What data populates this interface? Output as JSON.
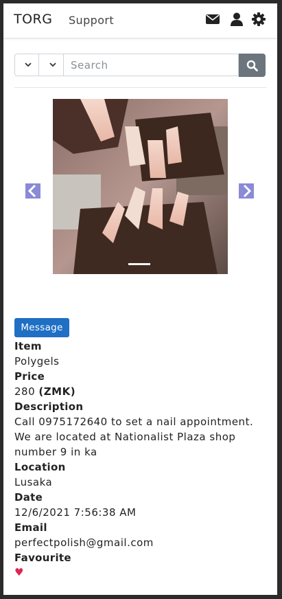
{
  "navbar": {
    "brand": "TORG",
    "support_link": "Support",
    "icons": [
      "envelope-icon",
      "user-icon",
      "gear-icon"
    ]
  },
  "search": {
    "placeholder": "Search",
    "value": "",
    "select1_value": "",
    "select2_value": ""
  },
  "carousel": {
    "slide_count": 1,
    "active_slide": 1
  },
  "listing": {
    "message_button": "Message",
    "item_label": "Item",
    "item_value": "Polygels",
    "price_label": "Price",
    "price_value": "280",
    "price_currency": "(ZMK)",
    "description_label": "Description",
    "description_value": "Call 0975172640 to set a nail appointment. We are located at Nationalist Plaza shop number 9 in ka",
    "location_label": "Location",
    "location_value": "Lusaka",
    "date_label": "Date",
    "date_value": "12/6/2021 7:56:38 AM",
    "email_label": "Email",
    "email_value": "perfectpolish@gmail.com",
    "favourite_label": "Favourite",
    "favourite_glyph": "♥"
  },
  "colors": {
    "primary": "#1f6fc4",
    "search_button": "#6c757d",
    "carousel_control": "#8a8ad6",
    "heart": "#dc2650"
  }
}
